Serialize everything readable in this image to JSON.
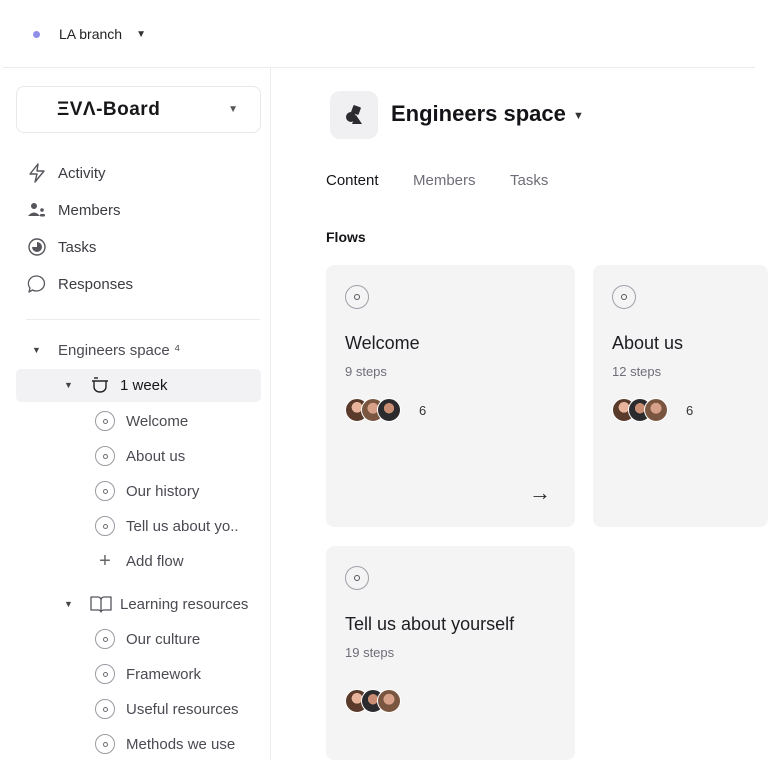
{
  "topbar": {
    "branch": "LA branch",
    "branch_caret": "▼"
  },
  "sidebar": {
    "board_logo": "ΞVΛ-Board",
    "board_caret": "▼",
    "nav": [
      {
        "label": "Activity",
        "icon": "lightning-icon"
      },
      {
        "label": "Members",
        "icon": "members-icon"
      },
      {
        "label": "Tasks",
        "icon": "tasks-icon"
      },
      {
        "label": "Responses",
        "icon": "chat-bubble-icon"
      }
    ],
    "tree": {
      "space": "Engineers space ⁴",
      "week": "1 week",
      "week_flows": [
        "Welcome",
        "About us",
        "Our history",
        "Tell us about yo.."
      ],
      "add_flow": "Add flow",
      "learning": "Learning resources",
      "learning_flows": [
        "Our culture",
        "Framework",
        "Useful resources",
        "Methods we use"
      ]
    }
  },
  "main": {
    "title": "Engineers space",
    "title_caret": "▼",
    "tabs": [
      "Content",
      "Members",
      "Tasks"
    ],
    "flows_heading": "Flows",
    "cards": [
      {
        "title": "Welcome",
        "steps": "9 steps",
        "count": "6",
        "arrow": "→"
      },
      {
        "title": "About us",
        "steps": "12 steps",
        "count": "6"
      },
      {
        "title": "Tell us about yourself",
        "steps": "19 steps",
        "count": ""
      }
    ]
  },
  "colors": {
    "accent_dot": "#8f8ee8",
    "card_bg": "#f4f4f5",
    "active_row": "#f2f2f4"
  }
}
